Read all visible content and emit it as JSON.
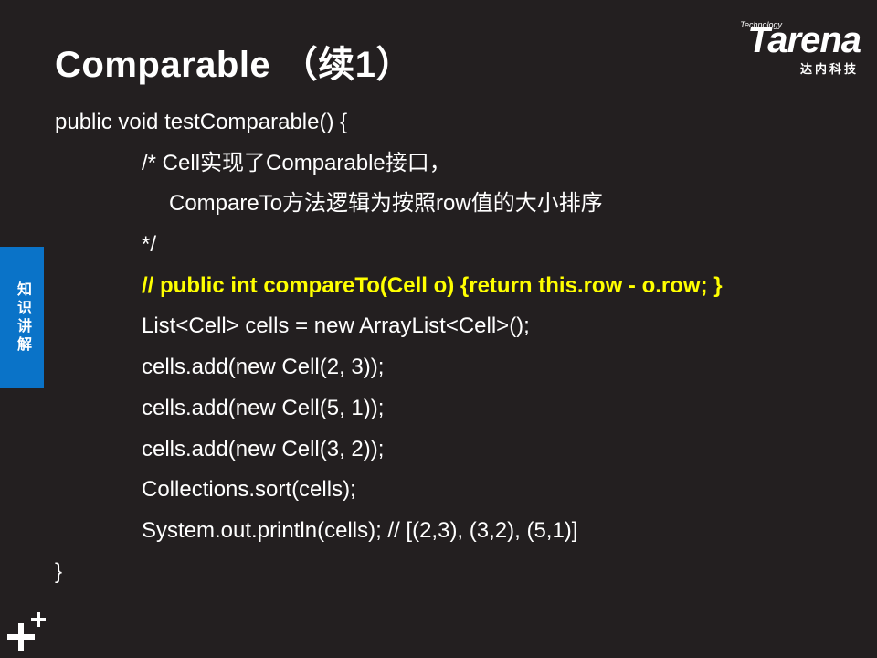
{
  "slide": {
    "title": "Comparable （续1）"
  },
  "logo": {
    "tech": "Technology",
    "name": "Tarena",
    "sub": "达内科技"
  },
  "side_tab": {
    "label": "知识讲解"
  },
  "code": {
    "lines": [
      "public void testComparable() {",
      "/* Cell实现了Comparable接口，",
      "CompareTo方法逻辑为按照row值的大小排序",
      "*/",
      "// public int compareTo(Cell o) {return this.row - o.row; }",
      "List<Cell> cells = new ArrayList<Cell>();",
      "cells.add(new Cell(2, 3));",
      "cells.add(new Cell(5, 1));",
      "cells.add(new Cell(3, 2));",
      "Collections.sort(cells);",
      "System.out.println(cells); // [(2,3), (3,2), (5,1)]",
      "}"
    ]
  },
  "colors": {
    "background": "#231f20",
    "text": "#ffffff",
    "highlight": "#ffff00",
    "side_tab": "#0a73c8"
  },
  "icons": {
    "bottom_left": "plus-plus-icon"
  }
}
